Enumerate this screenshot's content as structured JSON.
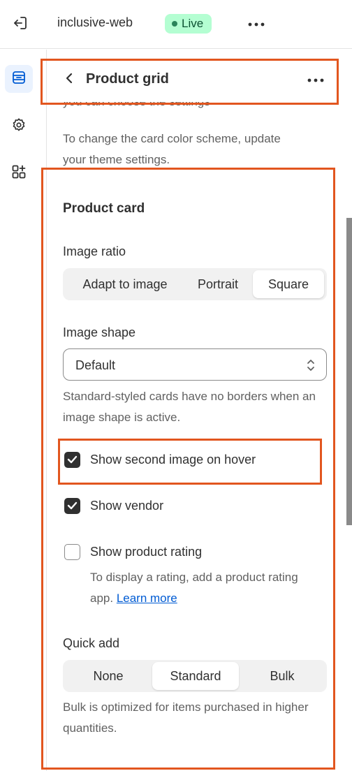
{
  "topbar": {
    "store_name": "inclusive-web",
    "status_label": "Live",
    "exit_icon": "exit-icon",
    "more_icon": "more-horizontal-icon"
  },
  "rail": {
    "items": [
      {
        "icon": "sections-icon",
        "active": true
      },
      {
        "icon": "gear-icon",
        "active": false
      },
      {
        "icon": "apps-icon",
        "active": false
      }
    ]
  },
  "panel": {
    "title": "Product grid",
    "cut_text": "you can choose the settings",
    "scheme_help": "To change the card color scheme, update your theme settings."
  },
  "product_card": {
    "section_title": "Product card",
    "image_ratio": {
      "label": "Image ratio",
      "options": [
        "Adapt to image",
        "Portrait",
        "Square"
      ],
      "selected": "Square"
    },
    "image_shape": {
      "label": "Image shape",
      "value": "Default",
      "help": "Standard-styled cards have no borders when an image shape is active."
    },
    "checkboxes": {
      "second_image": {
        "label": "Show second image on hover",
        "checked": true
      },
      "vendor": {
        "label": "Show vendor",
        "checked": true
      },
      "rating": {
        "label": "Show product rating",
        "checked": false
      }
    },
    "rating_help": {
      "text": "To display a rating, add a product rating app. ",
      "link": "Learn more"
    },
    "quick_add": {
      "label": "Quick add",
      "options": [
        "None",
        "Standard",
        "Bulk"
      ],
      "selected": "Standard",
      "help": "Bulk is optimized for items purchased in higher quantities."
    }
  },
  "colors": {
    "highlight": "#e2561f",
    "live_badge": "#b4fed2",
    "link": "#005bd3",
    "active_rail": "#eaf2fe"
  }
}
